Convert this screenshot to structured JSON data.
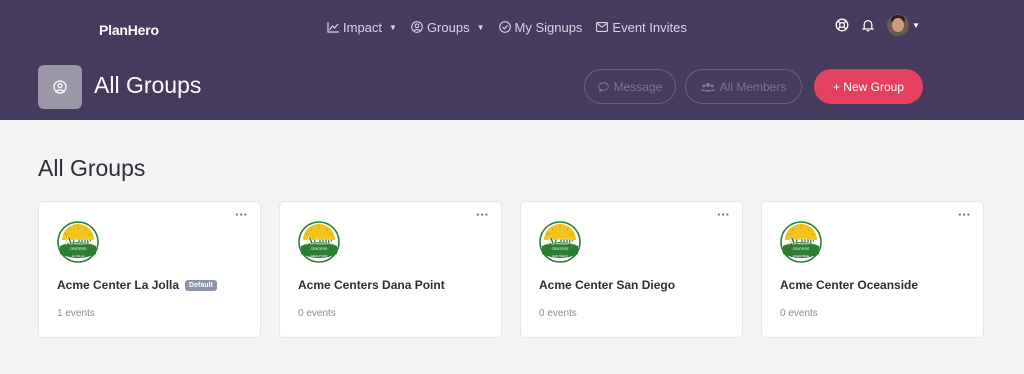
{
  "app": {
    "name": "PlanHero"
  },
  "nav": [
    {
      "label": "Impact",
      "icon": "chart-line-icon",
      "dropdown": true
    },
    {
      "label": "Groups",
      "icon": "user-circle-icon",
      "dropdown": true
    },
    {
      "label": "My Signups",
      "icon": "check-circle-icon",
      "dropdown": false
    },
    {
      "label": "Event Invites",
      "icon": "envelope-icon",
      "dropdown": false
    }
  ],
  "header_actions": {
    "help_icon": "lifebuoy-icon",
    "notifications_icon": "bell-icon",
    "avatar_icon": "user-avatar"
  },
  "page": {
    "title": "All Groups",
    "buttons": {
      "message": "Message",
      "all_members": "All Members",
      "new_group": "+ New Group"
    }
  },
  "section": {
    "title": "All Groups"
  },
  "groups": [
    {
      "name": "Acme Center La Jolla",
      "badge": "Default",
      "events": "1 events",
      "logo": {
        "word": "Acme",
        "sub": "CENTERS",
        "ribbon": "LA JOLLA"
      }
    },
    {
      "name": "Acme Centers Dana Point",
      "badge": "",
      "events": "0 events",
      "logo": {
        "word": "Acme",
        "sub": "CENTERS",
        "ribbon": "DANA POINT"
      }
    },
    {
      "name": "Acme Center San Diego",
      "badge": "",
      "events": "0 events",
      "logo": {
        "word": "Acme",
        "sub": "CENTERS",
        "ribbon": "SAN DIEGO"
      }
    },
    {
      "name": "Acme Center Oceanside",
      "badge": "",
      "events": "0 events",
      "logo": {
        "word": "Acme",
        "sub": "CENTERS",
        "ribbon": "OCEANSIDE"
      }
    }
  ],
  "colors": {
    "header": "#453b5e",
    "accent": "#e5405e",
    "badge": "#8d93a8",
    "logo_green": "#2e7d32",
    "logo_sun": "#f2c41d"
  }
}
